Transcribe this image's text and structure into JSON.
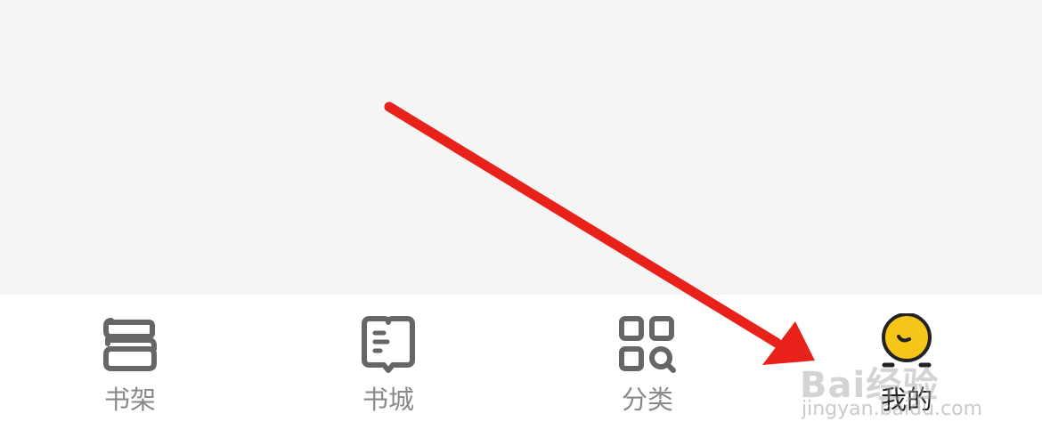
{
  "tab_bar": {
    "tabs": [
      {
        "label": "书架",
        "icon": "bookshelf-icon",
        "active": false
      },
      {
        "label": "书城",
        "icon": "book-store-icon",
        "active": false
      },
      {
        "label": "分类",
        "icon": "category-icon",
        "active": false
      },
      {
        "label": "我的",
        "icon": "profile-avatar-icon",
        "active": true
      }
    ]
  },
  "watermark": {
    "brand": "Bai经验",
    "url": "jingyan.baidu.com"
  },
  "colors": {
    "content_bg": "#f5f5f5",
    "tab_bg": "#ffffff",
    "inactive_label": "#8a8a8a",
    "active_label": "#222222",
    "icon_gray": "#666666",
    "avatar_yellow": "#f5c518",
    "annotation_arrow": "#e8221b"
  }
}
